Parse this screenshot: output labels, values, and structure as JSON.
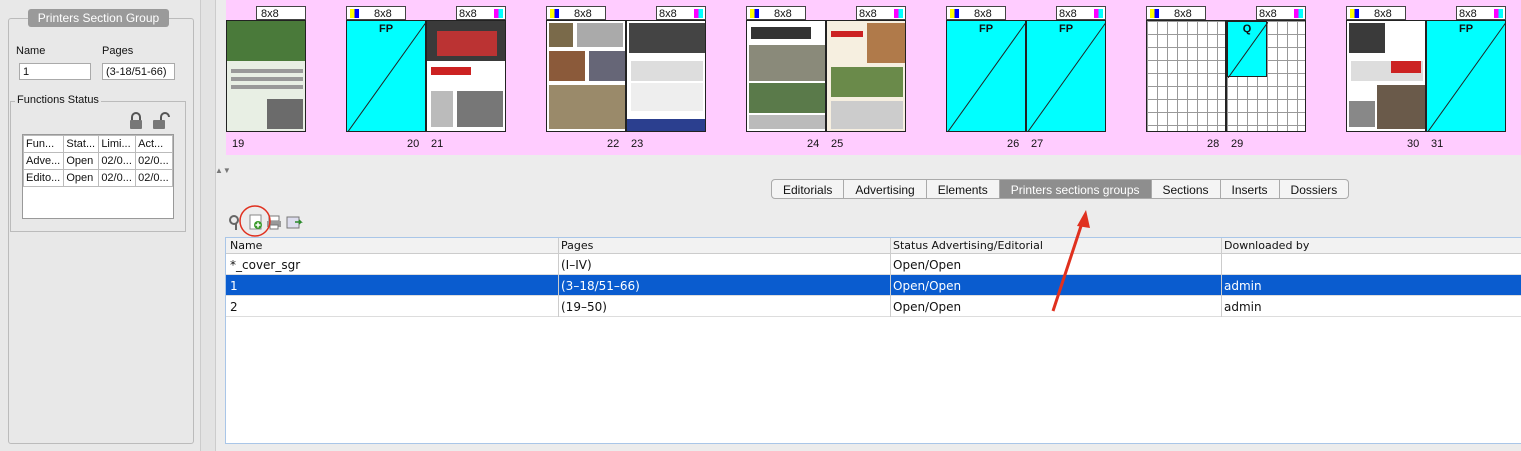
{
  "left": {
    "group_title": "Printers Section Group",
    "name_label": "Name",
    "pages_label": "Pages",
    "name_value": "1",
    "pages_value": "(3-18/51-66)",
    "functions_title": "Functions Status",
    "table": [
      [
        "Fun...",
        "Stat...",
        "Limi...",
        "Act..."
      ],
      [
        "Adve...",
        "Open",
        "02/0...",
        "02/0..."
      ],
      [
        "Edito...",
        "Open",
        "02/0...",
        "02/0..."
      ]
    ]
  },
  "pages": {
    "badge_label": "8x8",
    "fp_label": "FP",
    "q_label": "Q",
    "numbers": [
      "19",
      "20",
      "21",
      "22",
      "23",
      "24",
      "25",
      "26",
      "27",
      "28",
      "29",
      "30",
      "31"
    ]
  },
  "tabs": [
    "Editorials",
    "Advertising",
    "Elements",
    "Printers sections groups",
    "Sections",
    "Inserts",
    "Dossiers"
  ],
  "active_tab": "Printers sections groups",
  "grid": {
    "columns": [
      "Name",
      "Pages",
      "Status Advertising/Editorial",
      "Downloaded by"
    ],
    "rows": [
      [
        "*_cover_sgr",
        "(I–IV)",
        "Open/Open",
        ""
      ],
      [
        "1",
        "(3–18/51–66)",
        "Open/Open",
        "admin"
      ],
      [
        "2",
        "(19–50)",
        "Open/Open",
        "admin"
      ]
    ],
    "selected_row": 1
  },
  "colors": {
    "selection": "#0a5ccf",
    "pages_bg": "#ffccff",
    "fp": "#00ffff",
    "annotation": "#e0301e"
  }
}
